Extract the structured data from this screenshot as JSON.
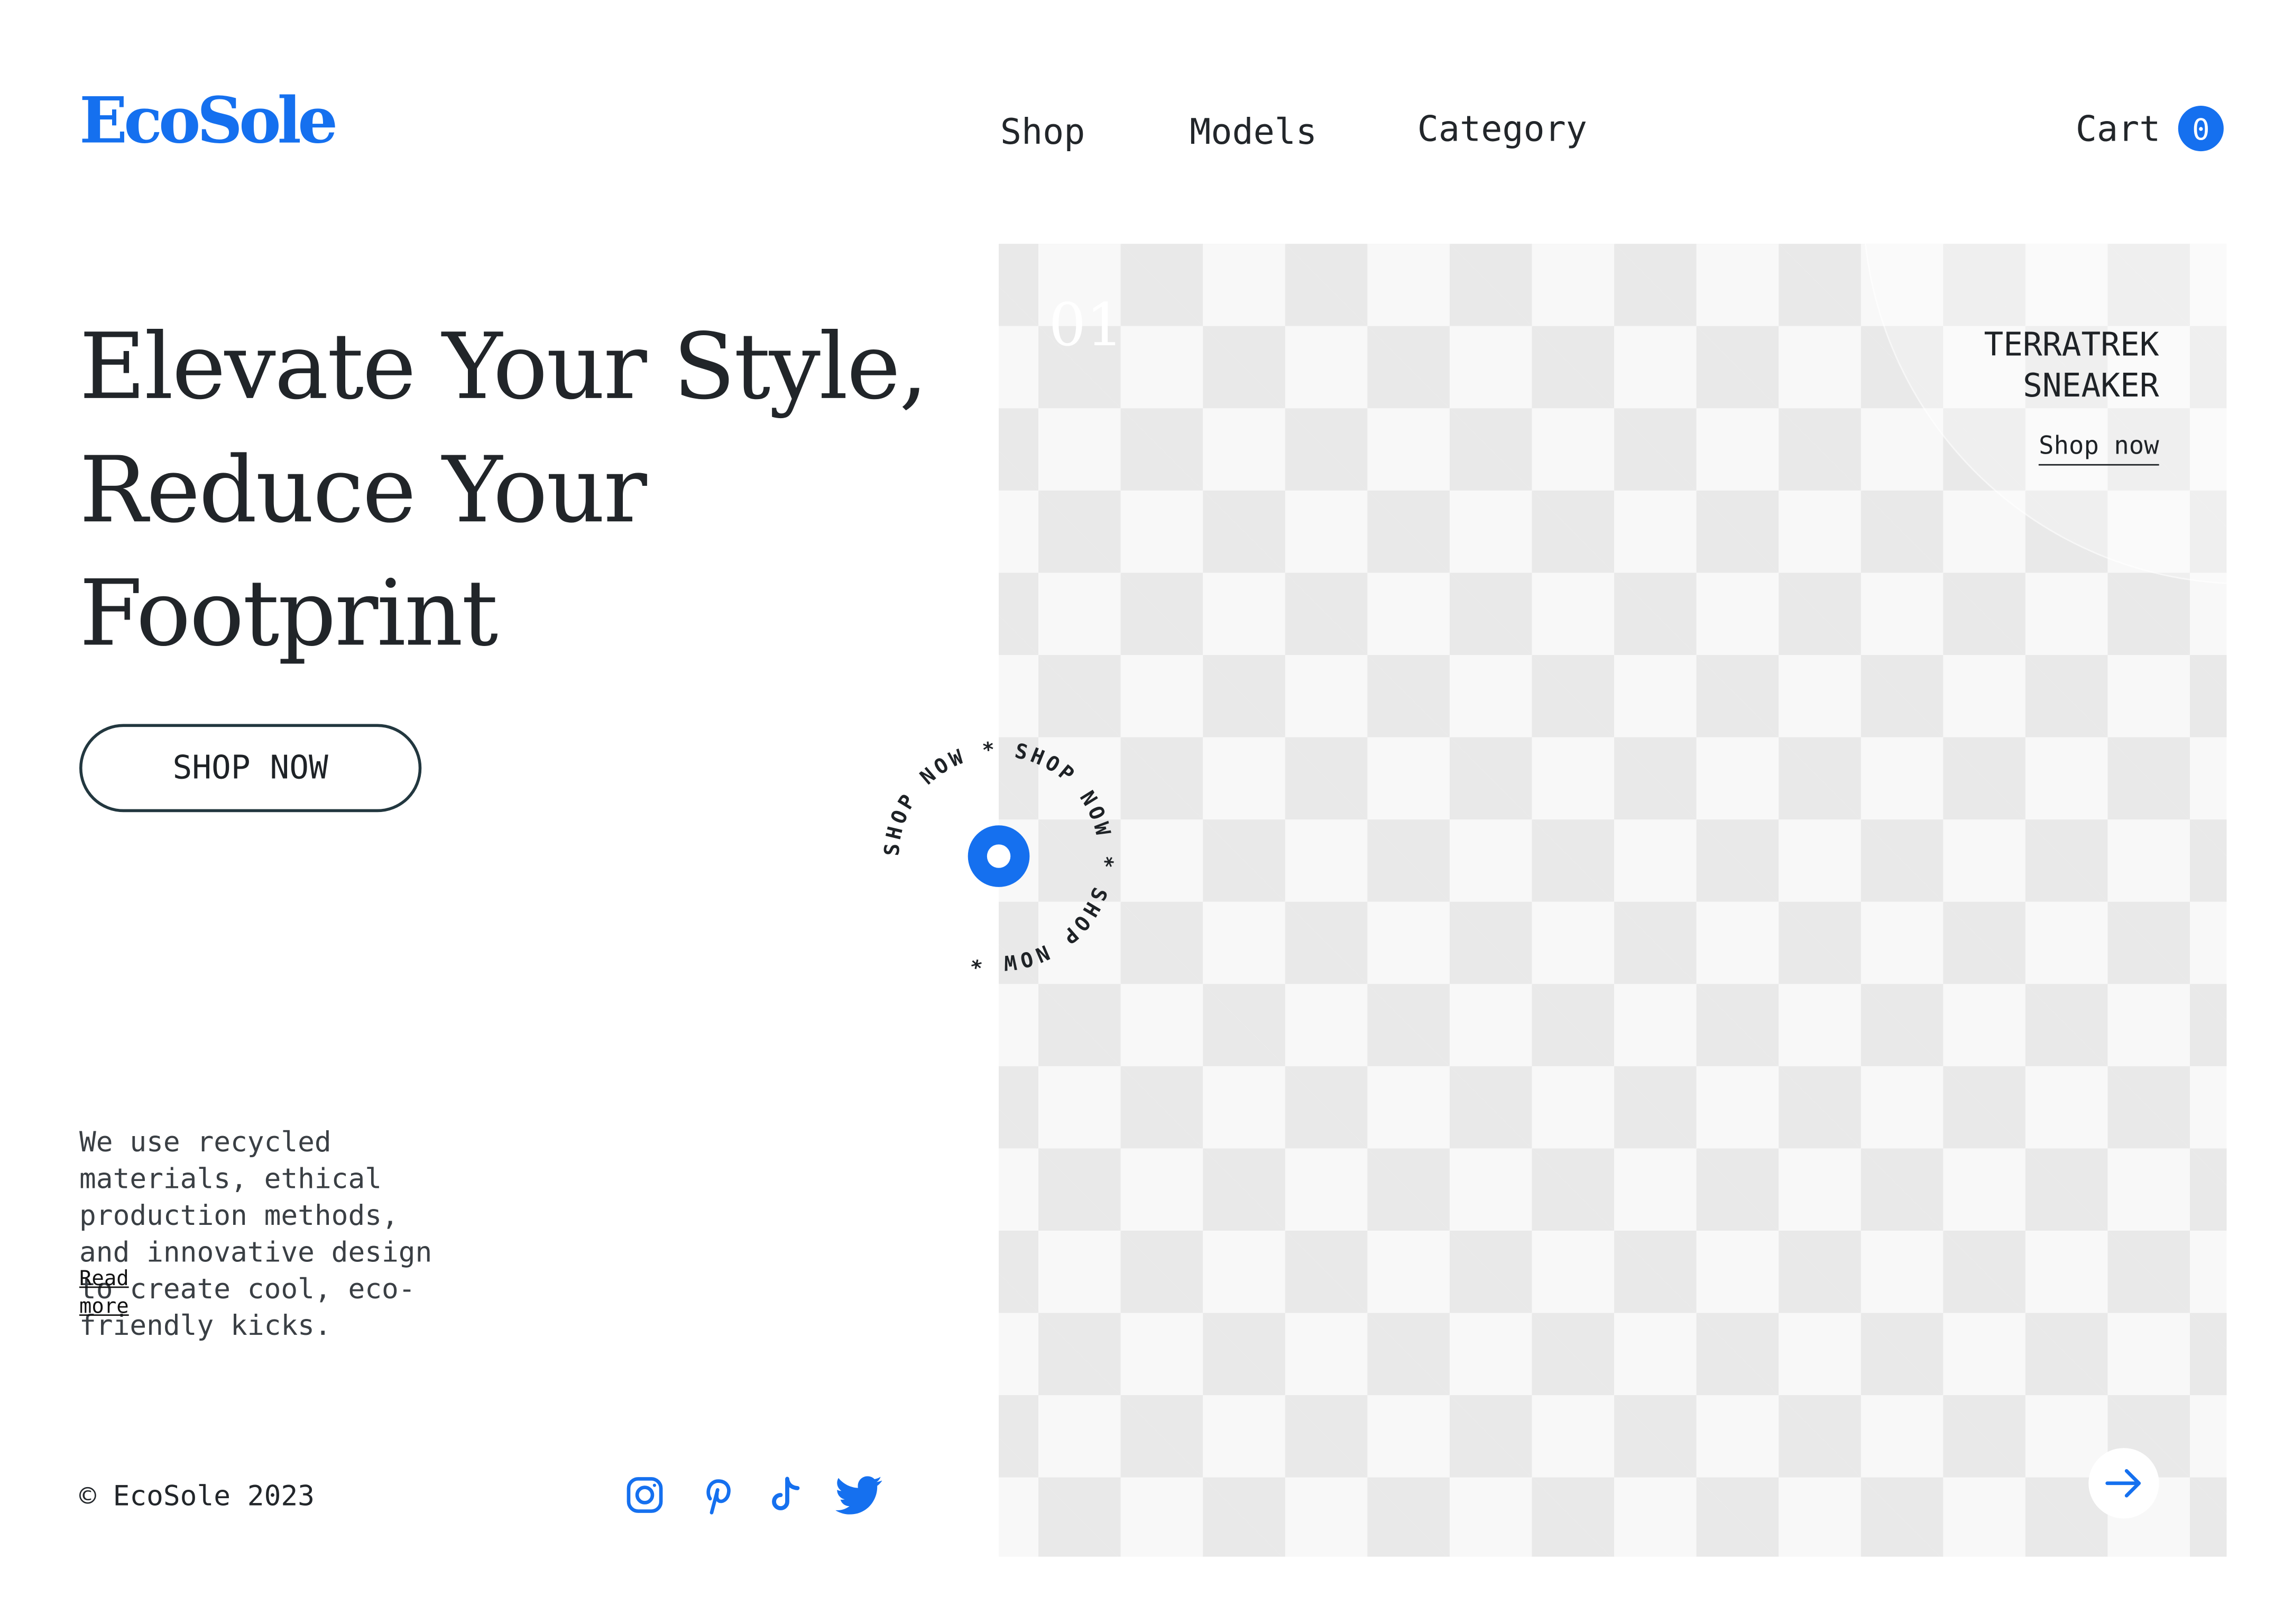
{
  "brand": {
    "name": "EcoSole",
    "accent": "#1570ef"
  },
  "nav": {
    "items": [
      {
        "label": "Shop"
      },
      {
        "label": "Models"
      },
      {
        "label": "Category"
      }
    ]
  },
  "cart": {
    "label": "Cart",
    "count": "0"
  },
  "hero": {
    "title_lines": [
      "Elevate Your Style,",
      "Reduce Your",
      "Footprint"
    ],
    "cta_label": "SHOP NOW",
    "description": "We use recycled materials, ethical production methods, and innovative design to create cool, eco-friendly kicks.",
    "read_more": "Read more"
  },
  "badge": {
    "text": "SHOP NOW * SHOP NOW * SHOP NOW * "
  },
  "product": {
    "slide_number": "01",
    "name_lines": [
      "TERRATREK",
      "SNEAKER"
    ],
    "link_label": "Shop now",
    "next_icon": "arrow-right-icon"
  },
  "footer": {
    "copyright": "© EcoSole 2023",
    "social": [
      "instagram-icon",
      "pinterest-icon",
      "tiktok-icon",
      "twitter-icon"
    ]
  }
}
